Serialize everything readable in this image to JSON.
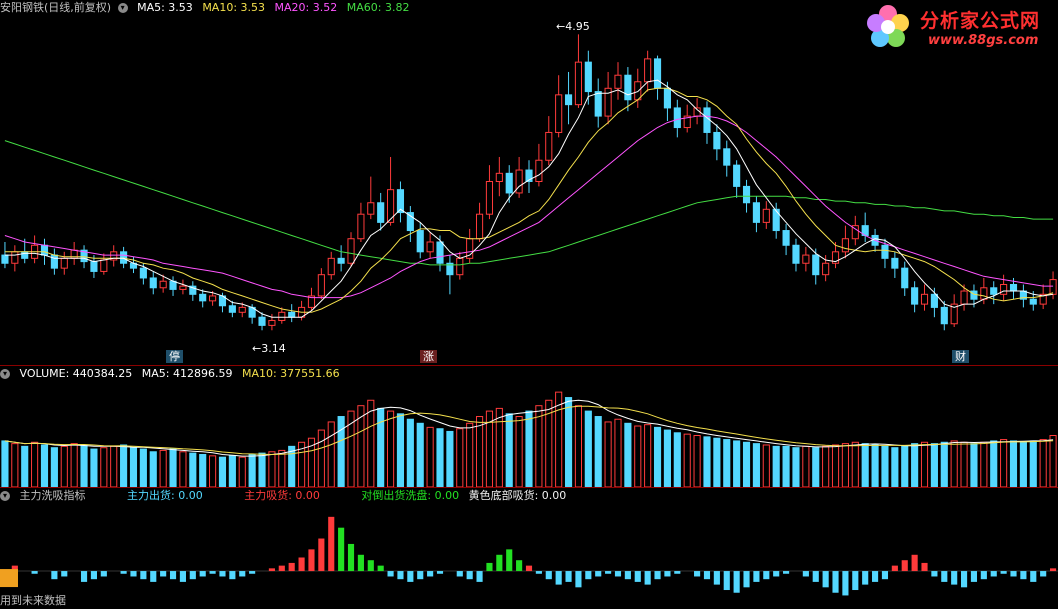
{
  "price": {
    "title": "安阳钢铁(日线,前复权)",
    "ma5": "MA5: 3.53",
    "ma10": "MA10: 3.53",
    "ma20": "MA20: 3.52",
    "ma60": "MA60: 3.82",
    "high_label": "4.95",
    "low_label": "3.14",
    "markers": [
      "停",
      "涨",
      "财"
    ]
  },
  "volume": {
    "title": "VOLUME: 440384.25",
    "ma5": "MA5: 412896.59",
    "ma10": "MA10: 377551.66"
  },
  "indicator": {
    "title": "主力洗吸指标",
    "out_label": "主力出货: 0.00",
    "in_label": "主力吸货: 0.00",
    "hedge_label": "对倒出货洗盘: 0.00",
    "yellow_label": "黄色底部吸货: 0.00",
    "footer": "用到未来数据"
  },
  "logo": {
    "name": "分析家公式网",
    "url": "www.88gs.com"
  },
  "colors": {
    "up": "#ff3b3b",
    "down": "#54d8ff",
    "ma5": "#ffffff",
    "ma10": "#f4e04d",
    "ma20": "#ff55ff",
    "ma60": "#44dd44",
    "hedge": "#22e022",
    "yellow": "#f0a020"
  },
  "chart_data": {
    "type": "candlestick",
    "candles": [
      [
        3.6,
        3.55,
        3.68,
        3.52
      ],
      [
        3.55,
        3.62,
        3.66,
        3.5
      ],
      [
        3.62,
        3.58,
        3.7,
        3.55
      ],
      [
        3.58,
        3.66,
        3.72,
        3.55
      ],
      [
        3.66,
        3.6,
        3.7,
        3.54
      ],
      [
        3.6,
        3.52,
        3.64,
        3.48
      ],
      [
        3.52,
        3.58,
        3.62,
        3.48
      ],
      [
        3.58,
        3.63,
        3.68,
        3.54
      ],
      [
        3.63,
        3.56,
        3.66,
        3.52
      ],
      [
        3.56,
        3.5,
        3.6,
        3.46
      ],
      [
        3.5,
        3.57,
        3.61,
        3.48
      ],
      [
        3.57,
        3.62,
        3.66,
        3.53
      ],
      [
        3.62,
        3.55,
        3.65,
        3.52
      ],
      [
        3.55,
        3.52,
        3.59,
        3.49
      ],
      [
        3.52,
        3.46,
        3.55,
        3.42
      ],
      [
        3.46,
        3.4,
        3.5,
        3.36
      ],
      [
        3.4,
        3.44,
        3.48,
        3.37
      ],
      [
        3.44,
        3.39,
        3.47,
        3.35
      ],
      [
        3.39,
        3.41,
        3.45,
        3.36
      ],
      [
        3.41,
        3.36,
        3.44,
        3.32
      ],
      [
        3.36,
        3.32,
        3.39,
        3.28
      ],
      [
        3.32,
        3.35,
        3.38,
        3.29
      ],
      [
        3.35,
        3.29,
        3.37,
        3.25
      ],
      [
        3.29,
        3.25,
        3.32,
        3.22
      ],
      [
        3.25,
        3.28,
        3.31,
        3.22
      ],
      [
        3.28,
        3.22,
        3.3,
        3.18
      ],
      [
        3.22,
        3.17,
        3.25,
        3.14
      ],
      [
        3.17,
        3.2,
        3.24,
        3.14
      ],
      [
        3.2,
        3.25,
        3.28,
        3.18
      ],
      [
        3.25,
        3.22,
        3.3,
        3.19
      ],
      [
        3.22,
        3.28,
        3.32,
        3.2
      ],
      [
        3.28,
        3.35,
        3.4,
        3.26
      ],
      [
        3.35,
        3.48,
        3.52,
        3.33
      ],
      [
        3.48,
        3.58,
        3.62,
        3.45
      ],
      [
        3.58,
        3.55,
        3.66,
        3.5
      ],
      [
        3.55,
        3.7,
        3.74,
        3.53
      ],
      [
        3.7,
        3.85,
        3.92,
        3.68
      ],
      [
        3.85,
        3.92,
        4.08,
        3.82
      ],
      [
        3.92,
        3.8,
        3.98,
        3.75
      ],
      [
        3.8,
        4.0,
        4.2,
        3.78
      ],
      [
        4.0,
        3.86,
        4.05,
        3.8
      ],
      [
        3.86,
        3.75,
        3.9,
        3.68
      ],
      [
        3.75,
        3.62,
        3.8,
        3.58
      ],
      [
        3.62,
        3.68,
        3.74,
        3.58
      ],
      [
        3.68,
        3.55,
        3.72,
        3.5
      ],
      [
        3.55,
        3.48,
        3.6,
        3.36
      ],
      [
        3.48,
        3.58,
        3.62,
        3.45
      ],
      [
        3.58,
        3.7,
        3.76,
        3.55
      ],
      [
        3.7,
        3.85,
        3.92,
        3.68
      ],
      [
        3.85,
        4.05,
        4.15,
        3.82
      ],
      [
        4.05,
        4.1,
        4.2,
        3.96
      ],
      [
        4.1,
        3.98,
        4.15,
        3.92
      ],
      [
        3.98,
        4.12,
        4.2,
        3.95
      ],
      [
        4.12,
        4.05,
        4.18,
        3.98
      ],
      [
        4.05,
        4.18,
        4.28,
        4.02
      ],
      [
        4.18,
        4.35,
        4.45,
        4.15
      ],
      [
        4.35,
        4.58,
        4.7,
        4.32
      ],
      [
        4.58,
        4.52,
        4.72,
        4.4
      ],
      [
        4.52,
        4.78,
        4.95,
        4.5
      ],
      [
        4.78,
        4.6,
        4.85,
        4.52
      ],
      [
        4.6,
        4.45,
        4.68,
        4.38
      ],
      [
        4.45,
        4.62,
        4.72,
        4.4
      ],
      [
        4.62,
        4.7,
        4.78,
        4.55
      ],
      [
        4.7,
        4.55,
        4.75,
        4.48
      ],
      [
        4.55,
        4.66,
        4.74,
        4.5
      ],
      [
        4.66,
        4.8,
        4.85,
        4.6
      ],
      [
        4.8,
        4.62,
        4.82,
        4.55
      ],
      [
        4.62,
        4.5,
        4.66,
        4.42
      ],
      [
        4.5,
        4.38,
        4.55,
        4.32
      ],
      [
        4.38,
        4.45,
        4.52,
        4.35
      ],
      [
        4.45,
        4.5,
        4.56,
        4.4
      ],
      [
        4.5,
        4.35,
        4.54,
        4.28
      ],
      [
        4.35,
        4.25,
        4.4,
        4.18
      ],
      [
        4.25,
        4.15,
        4.3,
        4.08
      ],
      [
        4.15,
        4.02,
        4.18,
        3.95
      ],
      [
        4.02,
        3.92,
        4.06,
        3.86
      ],
      [
        3.92,
        3.8,
        3.96,
        3.74
      ],
      [
        3.8,
        3.88,
        3.93,
        3.76
      ],
      [
        3.88,
        3.75,
        3.92,
        3.7
      ],
      [
        3.75,
        3.66,
        3.79,
        3.6
      ],
      [
        3.66,
        3.55,
        3.7,
        3.5
      ],
      [
        3.55,
        3.6,
        3.65,
        3.5
      ],
      [
        3.6,
        3.48,
        3.64,
        3.42
      ],
      [
        3.48,
        3.55,
        3.6,
        3.44
      ],
      [
        3.55,
        3.62,
        3.68,
        3.52
      ],
      [
        3.62,
        3.7,
        3.78,
        3.58
      ],
      [
        3.7,
        3.78,
        3.84,
        3.66
      ],
      [
        3.78,
        3.72,
        3.86,
        3.68
      ],
      [
        3.72,
        3.66,
        3.76,
        3.62
      ],
      [
        3.66,
        3.58,
        3.7,
        3.52
      ],
      [
        3.58,
        3.52,
        3.62,
        3.46
      ],
      [
        3.52,
        3.4,
        3.56,
        3.35
      ],
      [
        3.4,
        3.3,
        3.44,
        3.25
      ],
      [
        3.3,
        3.36,
        3.42,
        3.26
      ],
      [
        3.36,
        3.28,
        3.4,
        3.22
      ],
      [
        3.28,
        3.18,
        3.32,
        3.14
      ],
      [
        3.18,
        3.3,
        3.36,
        3.16
      ],
      [
        3.3,
        3.38,
        3.42,
        3.26
      ],
      [
        3.38,
        3.33,
        3.42,
        3.28
      ],
      [
        3.33,
        3.4,
        3.46,
        3.3
      ],
      [
        3.4,
        3.36,
        3.44,
        3.3
      ],
      [
        3.36,
        3.42,
        3.48,
        3.32
      ],
      [
        3.42,
        3.38,
        3.46,
        3.33
      ],
      [
        3.38,
        3.33,
        3.42,
        3.28
      ],
      [
        3.33,
        3.3,
        3.38,
        3.26
      ],
      [
        3.3,
        3.36,
        3.42,
        3.27
      ],
      [
        3.36,
        3.45,
        3.5,
        3.33
      ]
    ],
    "ma5": [
      3.6,
      3.6,
      3.61,
      3.61,
      3.6,
      3.58,
      3.58,
      3.58,
      3.58,
      3.56,
      3.57,
      3.58,
      3.58,
      3.55,
      3.53,
      3.5,
      3.47,
      3.44,
      3.42,
      3.4,
      3.38,
      3.37,
      3.35,
      3.31,
      3.3,
      3.28,
      3.24,
      3.22,
      3.22,
      3.22,
      3.22,
      3.26,
      3.32,
      3.38,
      3.44,
      3.53,
      3.63,
      3.72,
      3.76,
      3.82,
      3.88,
      3.84,
      3.8,
      3.74,
      3.69,
      3.62,
      3.58,
      3.6,
      3.66,
      3.73,
      3.86,
      3.95,
      4.02,
      4.06,
      4.09,
      4.14,
      4.22,
      4.34,
      4.44,
      4.57,
      4.59,
      4.59,
      4.61,
      4.58,
      4.6,
      4.66,
      4.67,
      4.63,
      4.58,
      4.55,
      4.49,
      4.44,
      4.39,
      4.33,
      4.25,
      4.14,
      4.03,
      3.95,
      3.87,
      3.8,
      3.73,
      3.67,
      3.61,
      3.57,
      3.56,
      3.59,
      3.63,
      3.67,
      3.7,
      3.69,
      3.65,
      3.58,
      3.5,
      3.43,
      3.37,
      3.3,
      3.28,
      3.3,
      3.3,
      3.33,
      3.35,
      3.38,
      3.38,
      3.38,
      3.36,
      3.35,
      3.36
    ],
    "ma10": [
      3.62,
      3.62,
      3.62,
      3.62,
      3.62,
      3.6,
      3.59,
      3.59,
      3.59,
      3.58,
      3.58,
      3.58,
      3.58,
      3.57,
      3.55,
      3.54,
      3.52,
      3.51,
      3.49,
      3.46,
      3.44,
      3.42,
      3.39,
      3.37,
      3.35,
      3.33,
      3.31,
      3.29,
      3.27,
      3.26,
      3.25,
      3.25,
      3.27,
      3.3,
      3.33,
      3.38,
      3.44,
      3.52,
      3.57,
      3.63,
      3.7,
      3.73,
      3.76,
      3.76,
      3.75,
      3.75,
      3.71,
      3.7,
      3.7,
      3.71,
      3.74,
      3.77,
      3.8,
      3.84,
      3.87,
      3.94,
      4.03,
      4.12,
      4.2,
      4.29,
      4.36,
      4.41,
      4.47,
      4.51,
      4.55,
      4.61,
      4.62,
      4.62,
      4.6,
      4.57,
      4.57,
      4.55,
      4.51,
      4.45,
      4.4,
      4.31,
      4.23,
      4.16,
      4.1,
      4.02,
      3.93,
      3.85,
      3.78,
      3.72,
      3.66,
      3.64,
      3.63,
      3.62,
      3.63,
      3.63,
      3.62,
      3.6,
      3.58,
      3.56,
      3.53,
      3.49,
      3.45,
      3.4,
      3.36,
      3.35,
      3.33,
      3.32,
      3.33,
      3.34,
      3.34,
      3.35,
      3.37
    ],
    "ma20": [
      3.72,
      3.7,
      3.68,
      3.67,
      3.66,
      3.65,
      3.64,
      3.63,
      3.62,
      3.61,
      3.6,
      3.6,
      3.6,
      3.59,
      3.58,
      3.57,
      3.55,
      3.54,
      3.53,
      3.52,
      3.51,
      3.5,
      3.49,
      3.47,
      3.45,
      3.43,
      3.41,
      3.39,
      3.38,
      3.36,
      3.35,
      3.34,
      3.34,
      3.34,
      3.34,
      3.35,
      3.37,
      3.4,
      3.43,
      3.46,
      3.5,
      3.53,
      3.56,
      3.58,
      3.59,
      3.6,
      3.61,
      3.62,
      3.63,
      3.65,
      3.68,
      3.71,
      3.74,
      3.77,
      3.8,
      3.85,
      3.9,
      3.95,
      4.0,
      4.05,
      4.1,
      4.15,
      4.2,
      4.25,
      4.3,
      4.34,
      4.38,
      4.41,
      4.43,
      4.44,
      4.45,
      4.45,
      4.44,
      4.42,
      4.39,
      4.35,
      4.3,
      4.25,
      4.2,
      4.14,
      4.08,
      4.02,
      3.96,
      3.9,
      3.85,
      3.8,
      3.76,
      3.72,
      3.69,
      3.67,
      3.65,
      3.63,
      3.61,
      3.59,
      3.57,
      3.55,
      3.53,
      3.51,
      3.49,
      3.47,
      3.46,
      3.45,
      3.44,
      3.43,
      3.42,
      3.41,
      3.41
    ],
    "ma60": [
      4.3,
      4.28,
      4.26,
      4.24,
      4.22,
      4.2,
      4.18,
      4.16,
      4.14,
      4.12,
      4.1,
      4.08,
      4.06,
      4.04,
      4.02,
      4.0,
      3.98,
      3.96,
      3.94,
      3.92,
      3.9,
      3.88,
      3.86,
      3.84,
      3.82,
      3.8,
      3.78,
      3.76,
      3.74,
      3.72,
      3.7,
      3.68,
      3.66,
      3.64,
      3.62,
      3.61,
      3.6,
      3.59,
      3.58,
      3.57,
      3.56,
      3.55,
      3.55,
      3.54,
      3.54,
      3.54,
      3.54,
      3.55,
      3.55,
      3.56,
      3.57,
      3.58,
      3.59,
      3.6,
      3.61,
      3.62,
      3.64,
      3.66,
      3.68,
      3.7,
      3.72,
      3.74,
      3.76,
      3.78,
      3.8,
      3.82,
      3.84,
      3.86,
      3.88,
      3.9,
      3.92,
      3.93,
      3.94,
      3.95,
      3.96,
      3.96,
      3.96,
      3.96,
      3.96,
      3.96,
      3.95,
      3.95,
      3.94,
      3.94,
      3.93,
      3.93,
      3.92,
      3.92,
      3.91,
      3.91,
      3.9,
      3.9,
      3.89,
      3.89,
      3.88,
      3.87,
      3.87,
      3.86,
      3.85,
      3.85,
      3.84,
      3.84,
      3.83,
      3.83,
      3.82,
      3.82,
      3.82
    ],
    "price_range": [
      3.05,
      5.05
    ],
    "volume": [
      340,
      320,
      300,
      330,
      310,
      290,
      300,
      320,
      310,
      280,
      290,
      300,
      310,
      290,
      280,
      260,
      270,
      280,
      260,
      250,
      240,
      230,
      220,
      230,
      220,
      240,
      250,
      260,
      270,
      300,
      330,
      360,
      420,
      480,
      520,
      560,
      600,
      640,
      580,
      560,
      540,
      500,
      470,
      440,
      430,
      410,
      430,
      470,
      520,
      560,
      580,
      540,
      520,
      560,
      600,
      640,
      700,
      660,
      600,
      560,
      520,
      480,
      500,
      470,
      450,
      460,
      440,
      420,
      400,
      390,
      380,
      370,
      360,
      350,
      340,
      330,
      320,
      310,
      300,
      300,
      290,
      300,
      290,
      300,
      310,
      320,
      330,
      320,
      310,
      300,
      290,
      300,
      320,
      330,
      320,
      330,
      340,
      330,
      320,
      330,
      340,
      350,
      340,
      330,
      340,
      350,
      380
    ],
    "volume_range": [
      0,
      760
    ],
    "indicator": [
      0,
      2,
      0,
      -1,
      0,
      -3,
      -2,
      0,
      -4,
      -3,
      -2,
      0,
      -1,
      -2,
      -3,
      -4,
      -2,
      -3,
      -4,
      -3,
      -2,
      -1,
      -2,
      -3,
      -2,
      -1,
      0,
      1,
      2,
      3,
      5,
      8,
      12,
      20,
      16,
      10,
      6,
      4,
      2,
      -2,
      -3,
      -4,
      -3,
      -2,
      -1,
      0,
      -2,
      -3,
      -4,
      3,
      6,
      8,
      4,
      2,
      -1,
      -3,
      -5,
      -4,
      -6,
      -3,
      -2,
      -1,
      -2,
      -3,
      -4,
      -5,
      -3,
      -2,
      -1,
      0,
      -2,
      -3,
      -5,
      -7,
      -8,
      -6,
      -4,
      -3,
      -2,
      -1,
      0,
      -2,
      -4,
      -6,
      -8,
      -9,
      -7,
      -5,
      -4,
      -3,
      2,
      4,
      6,
      3,
      -2,
      -4,
      -5,
      -6,
      -4,
      -3,
      -2,
      -1,
      -2,
      -3,
      -4,
      -2,
      1
    ],
    "indicator_range": [
      -14,
      24
    ]
  }
}
